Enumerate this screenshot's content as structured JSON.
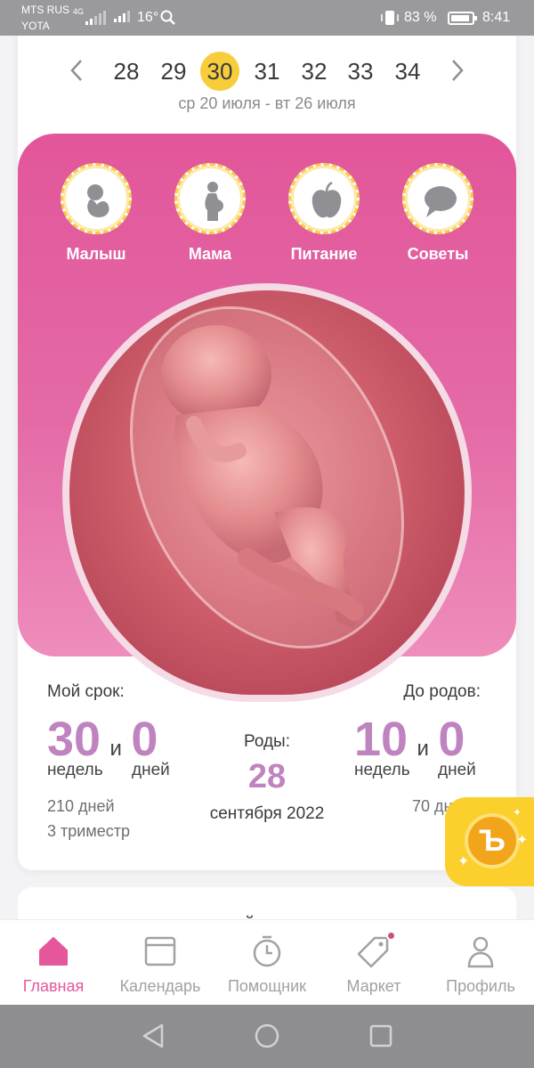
{
  "status_bar": {
    "carrier1": "MTS RUS",
    "carrier1_tech": "4G",
    "carrier2": "YOTA",
    "temperature": "16°",
    "battery": "83 %",
    "time": "8:41"
  },
  "week_nav": {
    "weeks": [
      "28",
      "29",
      "30",
      "31",
      "32",
      "33",
      "34"
    ],
    "selected": "30",
    "date_range": "ср 20 июля - вт 26 июля"
  },
  "categories": [
    {
      "label": "Малыш",
      "icon": "baby-icon"
    },
    {
      "label": "Мама",
      "icon": "pregnant-woman-icon"
    },
    {
      "label": "Питание",
      "icon": "apple-icon"
    },
    {
      "label": "Советы",
      "icon": "chat-bubble-icon"
    }
  ],
  "term": {
    "label": "Мой срок:",
    "weeks": "30",
    "and": "и",
    "days": "0",
    "weeks_unit": "недель",
    "days_unit": "дней",
    "total_days": "210 дней",
    "trimester": "3 триместр"
  },
  "birth": {
    "label": "Роды:",
    "day": "28",
    "month_year": "сентября 2022"
  },
  "until_birth": {
    "label": "До родов:",
    "weeks": "10",
    "and": "и",
    "days": "0",
    "weeks_unit": "недель",
    "days_unit": "дней",
    "total_days": "70 дн"
  },
  "bonus": {
    "symbol": "Ъ"
  },
  "next_card": {
    "title": "мой малыш как"
  },
  "tabbar": {
    "items": [
      {
        "label": "Главная",
        "icon": "home-icon",
        "active": true
      },
      {
        "label": "Календарь",
        "icon": "calendar-icon",
        "active": false
      },
      {
        "label": "Помощник",
        "icon": "stopwatch-icon",
        "active": false
      },
      {
        "label": "Маркет",
        "icon": "price-tag-icon",
        "active": false
      },
      {
        "label": "Профиль",
        "icon": "profile-icon",
        "active": false
      }
    ]
  },
  "colors": {
    "accent": "#e4579a",
    "selected_week": "#f7cd3c",
    "number": "#bf83bf",
    "coin": "#fbcf2c"
  }
}
